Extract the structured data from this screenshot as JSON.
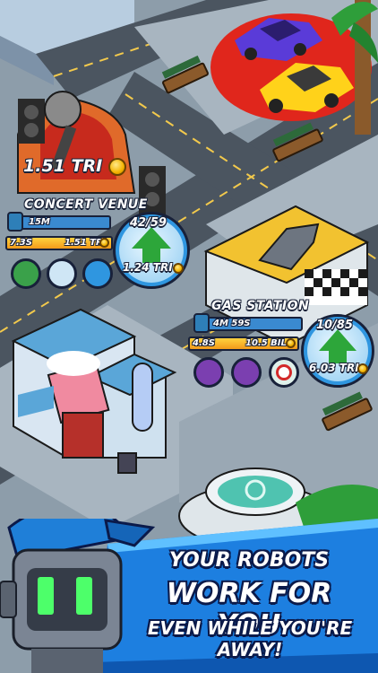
{
  "game": {
    "accent": "#1aa0f0",
    "panel_bg": "#18213a"
  },
  "concert": {
    "earnings": "1.51 TRI",
    "title": "CONCERT VENUE",
    "timer": "15M",
    "multiplier": "7.3S",
    "income": "1.51 TRI",
    "count": "42/59",
    "upgrade_cost": "1.24 TRI"
  },
  "gas": {
    "title": "GAS STATION",
    "timer": "4M 59S",
    "multiplier": "4.8S",
    "income": "10.5 BIL",
    "count": "10/85",
    "upgrade_cost": "6.03 TRI"
  },
  "banner": {
    "line1": "YOUR ROBOTS",
    "line2": "WORK FOR YOU",
    "line3": "EVEN WHILE YOU'RE AWAY!"
  }
}
